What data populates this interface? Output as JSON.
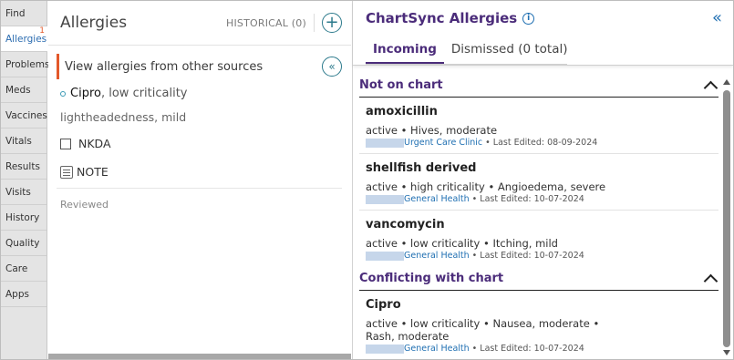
{
  "rail": {
    "items": [
      {
        "label": "Find",
        "active": false,
        "badge": ""
      },
      {
        "label": "Allergies",
        "active": true,
        "badge": "1"
      },
      {
        "label": "Problems",
        "active": false,
        "badge": ""
      },
      {
        "label": "Meds",
        "active": false,
        "badge": ""
      },
      {
        "label": "Vaccines",
        "active": false,
        "badge": ""
      },
      {
        "label": "Vitals",
        "active": false,
        "badge": ""
      },
      {
        "label": "Results",
        "active": false,
        "badge": ""
      },
      {
        "label": "Visits",
        "active": false,
        "badge": ""
      },
      {
        "label": "History",
        "active": false,
        "badge": ""
      },
      {
        "label": "Quality",
        "active": false,
        "badge": ""
      },
      {
        "label": "Care",
        "active": false,
        "badge": ""
      },
      {
        "label": "Apps",
        "active": false,
        "badge": ""
      }
    ]
  },
  "allergies": {
    "title": "Allergies",
    "historical": "HISTORICAL (0)",
    "add_icon": "+",
    "view_other": "View allergies from other sources",
    "collapse_icon": "«",
    "item": {
      "name": "Cipro",
      "criticality": ", low criticality",
      "reaction": "lightheadedness, mild"
    },
    "nkda_label": "NKDA",
    "note_label": "NOTE",
    "reviewed": "Reviewed"
  },
  "chartsync": {
    "title": "ChartSync Allergies",
    "info_icon": "i",
    "collapse_icon": "«",
    "tabs": [
      {
        "label": "Incoming",
        "active": true
      },
      {
        "label": "Dismissed (0 total)",
        "active": false
      }
    ],
    "sections": [
      {
        "title": "Not on chart",
        "cards": [
          {
            "name": "amoxicillin",
            "detail": "active • Hives, moderate",
            "source": "Urgent Care Clinic",
            "edited": "• Last Edited: 08-09-2024"
          },
          {
            "name": "shellfish derived",
            "detail": "active • high criticality • Angioedema, severe",
            "source": "General Health",
            "edited": "• Last Edited: 10-07-2024"
          },
          {
            "name": "vancomycin",
            "detail": "active • low criticality • Itching, mild",
            "source": "General Health",
            "edited": "• Last Edited: 10-07-2024"
          }
        ]
      },
      {
        "title": "Conflicting with chart",
        "cards": [
          {
            "name": "Cipro",
            "detail": "active • low criticality • Nausea, moderate •",
            "detail2": "Rash, moderate",
            "source": "General Health",
            "edited": "• Last Edited: 10-07-2024"
          }
        ]
      }
    ]
  }
}
